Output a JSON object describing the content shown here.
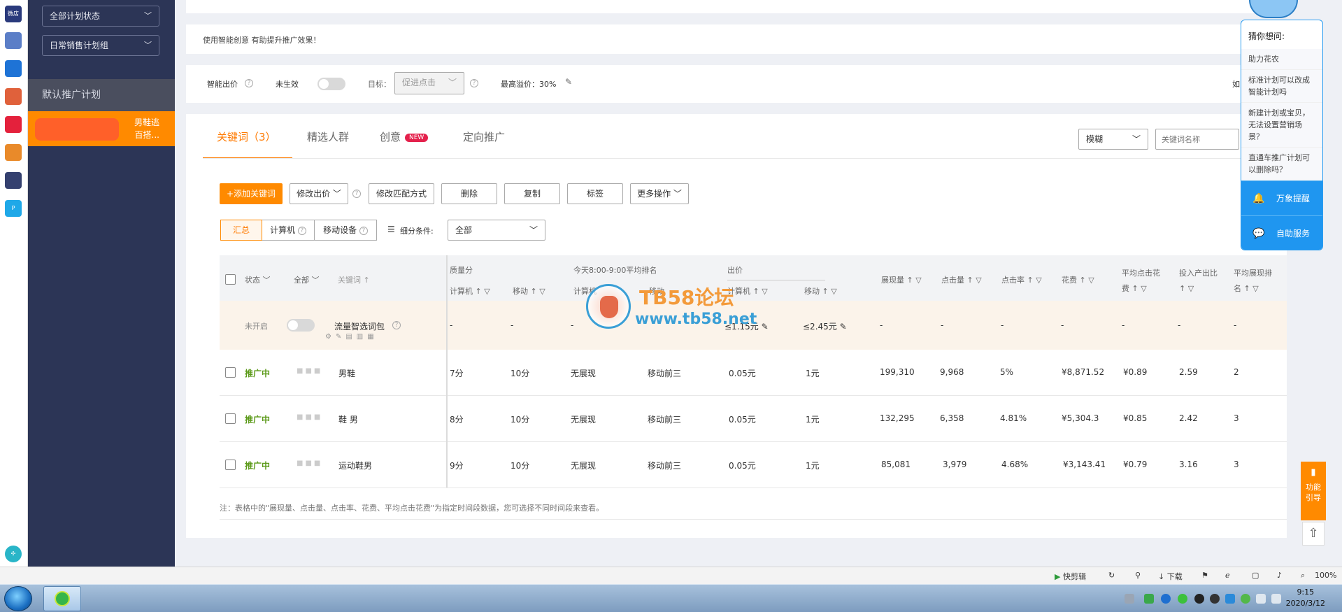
{
  "dock": {
    "icons": [
      {
        "name": "app-icon-1",
        "label": "微店",
        "color": "#2a3a7c"
      },
      {
        "name": "app-icon-2",
        "label": "",
        "color": "#5b7ec7"
      },
      {
        "name": "app-icon-3",
        "label": "",
        "color": "#1e73d6"
      },
      {
        "name": "app-icon-4",
        "label": "",
        "color": "#e0613b"
      },
      {
        "name": "app-icon-5",
        "label": "",
        "color": "#e4213c"
      },
      {
        "name": "app-icon-6",
        "label": "",
        "color": "#e98a2a"
      },
      {
        "name": "app-icon-7",
        "label": "",
        "color": "#34406f"
      },
      {
        "name": "app-icon-8",
        "label": "P",
        "color": "#1fa8e8"
      }
    ]
  },
  "sidebar": {
    "status_filter": "全部计划状态",
    "group_filter": "日常销售计划组",
    "group_label": "默认推广计划",
    "plan_label_line1": "男鞋逃",
    "plan_label_line2": "百搭..."
  },
  "notice": {
    "text": "使用智能创意  有助提升推广效果！"
  },
  "smart_bid": {
    "label": "智能出价",
    "state": "未生效",
    "target_label": "目标：",
    "target_value": "促进点击",
    "max_premium": "最高溢价：30%",
    "right_cut": "如"
  },
  "tabs": {
    "keywords": "关键词（3）",
    "crowd": "精选人群",
    "creative": "创意",
    "creative_badge": "NEW",
    "targeting": "定向推广"
  },
  "search": {
    "match_mode": "模糊",
    "placeholder": "关键词名称"
  },
  "toolbar": {
    "add_keyword": "+添加关键词",
    "modify_bid": "修改出价",
    "modify_match": "修改匹配方式",
    "delete": "删除",
    "copy": "复制",
    "tag": "标签",
    "more": "更多操作"
  },
  "view": {
    "summary": "汇总",
    "computer": "计算机",
    "mobile": "移动设备",
    "breakdown_label": "细分条件:",
    "breakdown_value": "全部"
  },
  "table_header": {
    "status": "状态",
    "all": "全部",
    "keyword": "关键词",
    "quality_score": "质量分",
    "computer": "计算机",
    "mobile": "移动",
    "rank_today": "今天8:00-9:00平均排名",
    "rank_computer": "计算机",
    "rank_mobile": "移动",
    "bid": "出价",
    "bid_computer": "计算机",
    "bid_mobile": "移动",
    "impressions": "展现量",
    "clicks": "点击量",
    "ctr": "点击率",
    "cost": "花费",
    "avg_cpc_line1": "平均点击花",
    "avg_cpc_line2": "费",
    "roi": "投入产出比",
    "avg_rank_line1": "平均展现排",
    "avg_rank_line2": "名"
  },
  "package_row": {
    "status": "未开启",
    "name": "流量智选词包",
    "q_pc": "-",
    "q_mobile": "-",
    "rank_pc": "-",
    "bid_pc": "≤1.15元",
    "bid_mobile": "≤2.45元",
    "impressions": "-",
    "clicks": "-",
    "ctr": "-",
    "cost": "-",
    "avg_cpc": "-",
    "roi": "-",
    "avg_rank": "-"
  },
  "rows": [
    {
      "status": "推广中",
      "keyword": "男鞋",
      "q_pc": "7分",
      "q_mobile": "10分",
      "rank_pc": "无展现",
      "rank_mobile": "移动前三",
      "bid_pc": "0.05元",
      "bid_mobile": "1元",
      "impressions": "199,310",
      "clicks": "9,968",
      "ctr": "5%",
      "cost": "¥8,871.52",
      "avg_cpc": "¥0.89",
      "roi": "2.59",
      "avg_rank": "2"
    },
    {
      "status": "推广中",
      "keyword": "鞋 男",
      "q_pc": "8分",
      "q_mobile": "10分",
      "rank_pc": "无展现",
      "rank_mobile": "移动前三",
      "bid_pc": "0.05元",
      "bid_mobile": "1元",
      "impressions": "132,295",
      "clicks": "6,358",
      "ctr": "4.81%",
      "cost": "¥5,304.3",
      "avg_cpc": "¥0.85",
      "roi": "2.42",
      "avg_rank": "3"
    },
    {
      "status": "推广中",
      "keyword": "运动鞋男",
      "q_pc": "9分",
      "q_mobile": "10分",
      "rank_pc": "无展现",
      "rank_mobile": "移动前三",
      "bid_pc": "0.05元",
      "bid_mobile": "1元",
      "impressions": "85,081",
      "clicks": "3,979",
      "ctr": "4.68%",
      "cost": "¥3,143.41",
      "avg_cpc": "¥0.79",
      "roi": "3.16",
      "avg_rank": "3"
    }
  ],
  "footnote": "注：表格中的\"展现量、点击量、点击率、花费、平均点击花费\"为指定时间段数据，您可选择不同时间段来查看。",
  "help": {
    "title": "猜你想问:",
    "questions": [
      "助力花农",
      "标准计划可以改成智能计划吗",
      "新建计划或宝贝，无法设置营销场景？",
      "直通车推广计划可以删除吗？"
    ],
    "reminder": "万象提醒",
    "self_service": "自助服务"
  },
  "side_float": {
    "guide": "功能引导"
  },
  "watermark": {
    "title": "TB58论坛",
    "url": "www.tb58.net"
  },
  "statusbar": {
    "clip": "快剪辑",
    "download": "下载",
    "zoom": "100%"
  },
  "clock": {
    "time": "9:15",
    "date": "2020/3/12"
  }
}
